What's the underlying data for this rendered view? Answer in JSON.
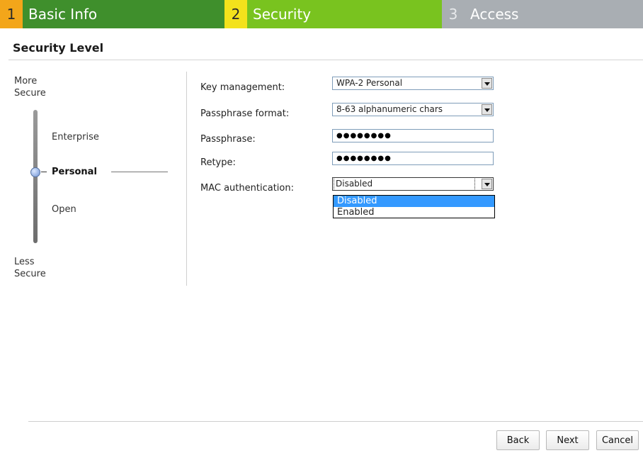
{
  "steps": [
    {
      "num": "1",
      "label": "Basic Info"
    },
    {
      "num": "2",
      "label": "Security"
    },
    {
      "num": "3",
      "label": "Access"
    }
  ],
  "colors": {
    "step1": "#3f8f2c",
    "step1_num": "#f3a61a",
    "step2": "#79c31f",
    "step2_num": "#f3e21c",
    "step3": "#a9aeb3",
    "selection": "#3399ff"
  },
  "section_title": "Security Level",
  "slider": {
    "top_label": [
      "More",
      "Secure"
    ],
    "bottom_label": [
      "Less",
      "Secure"
    ],
    "options": [
      "Enterprise",
      "Personal",
      "Open"
    ],
    "selected": "Personal"
  },
  "form": {
    "key_management": {
      "label": "Key management:",
      "value": "WPA-2 Personal"
    },
    "passphrase_format": {
      "label": "Passphrase format:",
      "value": "8-63 alphanumeric chars"
    },
    "passphrase": {
      "label": "Passphrase:",
      "value": "●●●●●●●●"
    },
    "retype": {
      "label": "Retype:",
      "value": "●●●●●●●●"
    },
    "mac_auth": {
      "label": "MAC authentication:",
      "value": "Disabled",
      "options": [
        "Disabled",
        "Enabled"
      ],
      "highlighted": "Disabled"
    }
  },
  "buttons": {
    "back": "Back",
    "next": "Next",
    "cancel": "Cancel"
  },
  "icons": [
    "dropdown-arrow-icon",
    "slider-knob-icon"
  ]
}
